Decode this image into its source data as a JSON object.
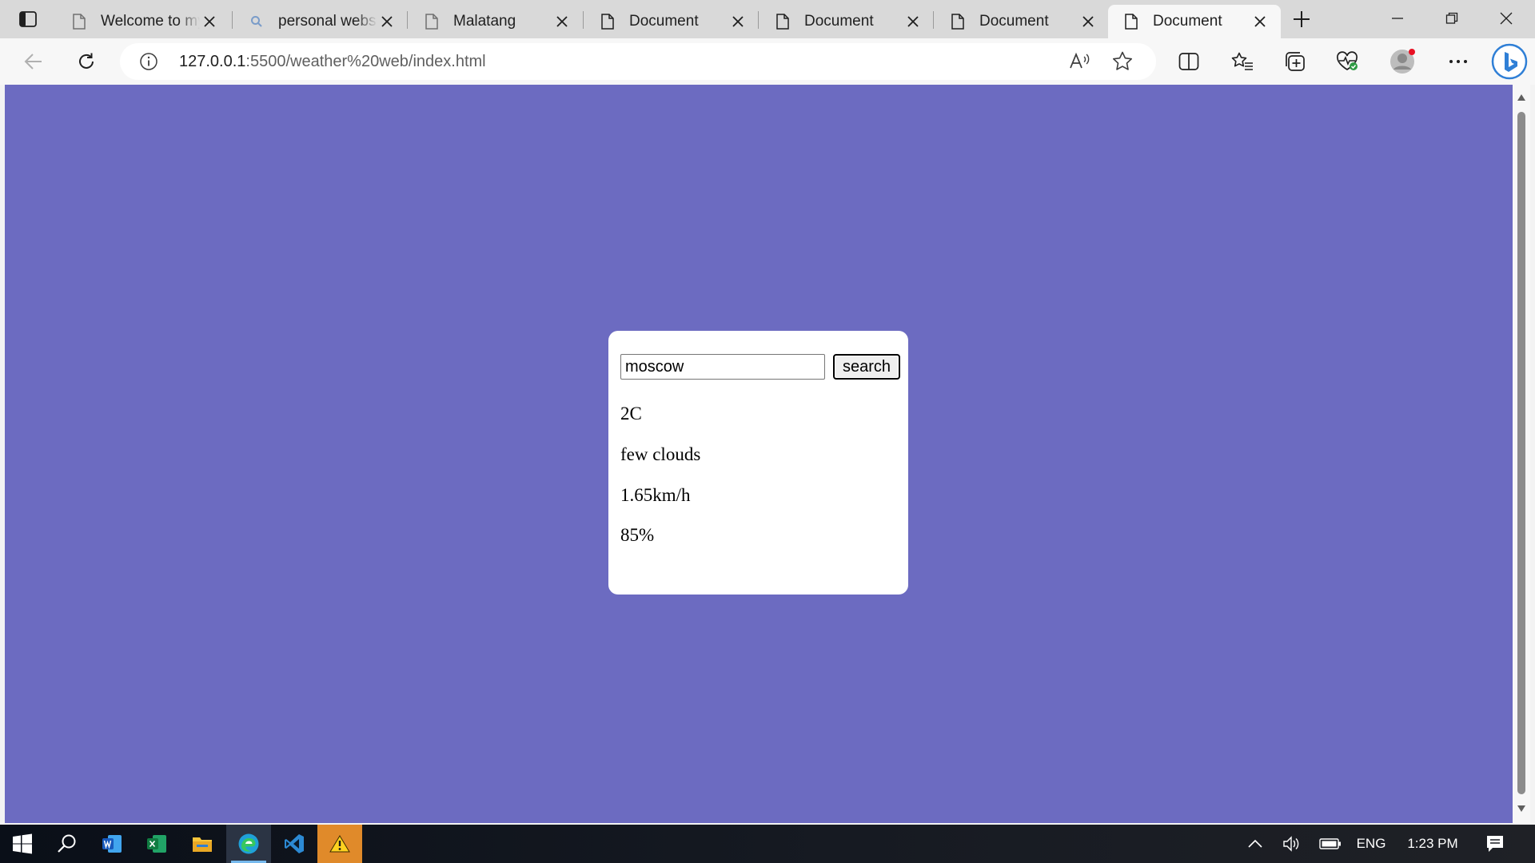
{
  "tabs": [
    {
      "title": "Welcome to my"
    },
    {
      "title": "personal websit"
    },
    {
      "title": "Malatang"
    },
    {
      "title": "Document"
    },
    {
      "title": "Document"
    },
    {
      "title": "Document"
    },
    {
      "title": "Document"
    }
  ],
  "address": {
    "host": "127.0.0.1",
    "path": ":5500/weather%20web/index.html"
  },
  "weather": {
    "city_value": "moscow",
    "search_label": "search",
    "temperature": "2C",
    "description": "few clouds",
    "wind": "1.65km/h",
    "humidity": "85%"
  },
  "colors": {
    "page_background": "#6c6bc1",
    "card_background": "#ffffff",
    "taskbar_active_underline": "#76b9ed"
  },
  "taskbar": {
    "language": "ENG",
    "time": "1:23 PM"
  }
}
